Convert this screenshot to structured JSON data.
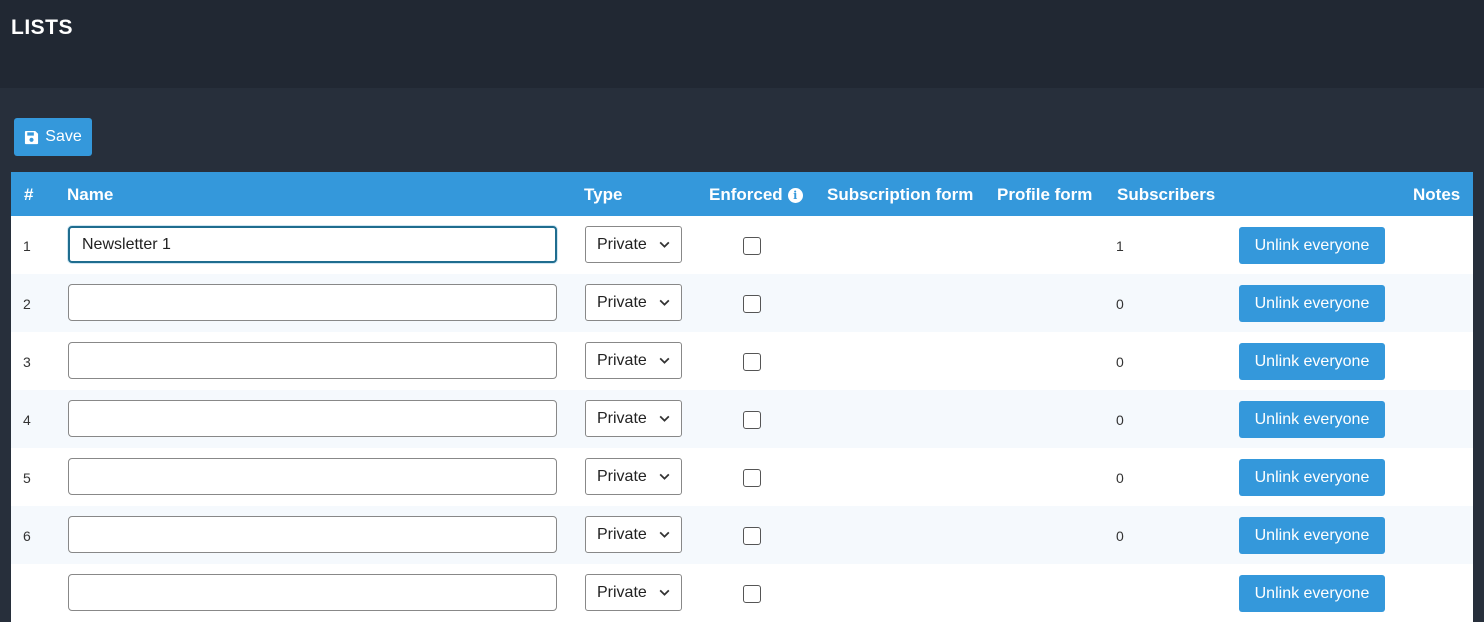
{
  "header": {
    "title": "LISTS"
  },
  "toolbar": {
    "save_label": "Save"
  },
  "table": {
    "columns": {
      "num": "#",
      "name": "Name",
      "type": "Type",
      "enforced": "Enforced",
      "subscription_form": "Subscription form",
      "profile_form": "Profile form",
      "subscribers": "Subscribers",
      "notes": "Notes"
    },
    "rows": [
      {
        "num": "1",
        "name": "Newsletter 1",
        "type": "Private",
        "enforced": false,
        "subscribers": "1",
        "action": "Unlink everyone"
      },
      {
        "num": "2",
        "name": "",
        "type": "Private",
        "enforced": false,
        "subscribers": "0",
        "action": "Unlink everyone"
      },
      {
        "num": "3",
        "name": "",
        "type": "Private",
        "enforced": false,
        "subscribers": "0",
        "action": "Unlink everyone"
      },
      {
        "num": "4",
        "name": "",
        "type": "Private",
        "enforced": false,
        "subscribers": "0",
        "action": "Unlink everyone"
      },
      {
        "num": "5",
        "name": "",
        "type": "Private",
        "enforced": false,
        "subscribers": "0",
        "action": "Unlink everyone"
      },
      {
        "num": "6",
        "name": "",
        "type": "Private",
        "enforced": false,
        "subscribers": "0",
        "action": "Unlink everyone"
      },
      {
        "num": "",
        "name": "",
        "type": "Private",
        "enforced": false,
        "subscribers": "",
        "action": "Unlink everyone"
      }
    ]
  },
  "colors": {
    "accent": "#3498db",
    "header_bg": "#212833",
    "page_bg": "#272f3b"
  }
}
